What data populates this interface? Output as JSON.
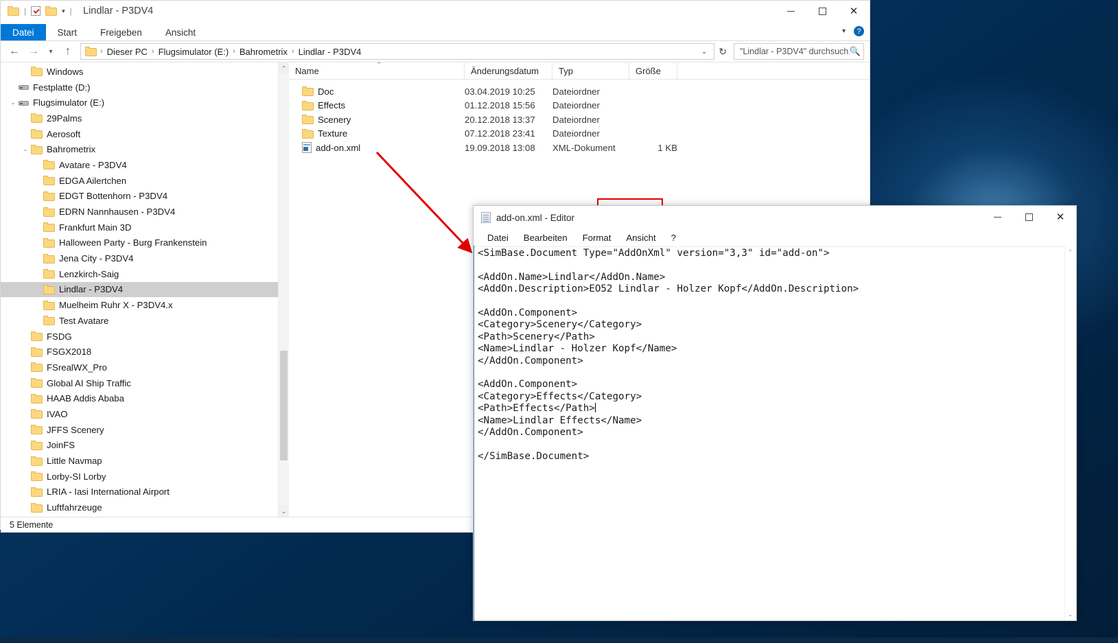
{
  "explorer": {
    "title": "Lindlar - P3DV4",
    "quick_access": {
      "folder_icon": "folder-icon",
      "properties_icon": "checkbox-red-check-icon",
      "new_folder_icon": "folder-icon",
      "dropdown_icon": "chevron-down-icon"
    },
    "ribbon_tabs": [
      {
        "label": "Datei",
        "active": true
      },
      {
        "label": "Start",
        "active": false
      },
      {
        "label": "Freigeben",
        "active": false
      },
      {
        "label": "Ansicht",
        "active": false
      }
    ],
    "ribbon_right": {
      "collapse_icon": "chevron-down-icon",
      "help_icon": "help-icon",
      "help_label": "?"
    },
    "window_controls": {
      "minimize": "minimize-icon",
      "maximize": "maximize-icon",
      "close": "close-icon"
    },
    "nav": {
      "back_icon": "arrow-left-icon",
      "forward_icon": "arrow-right-icon",
      "recent_icon": "chevron-down-icon",
      "up_icon": "arrow-up-icon"
    },
    "breadcrumbs": [
      "Dieser PC",
      "Flugsimulator (E:)",
      "Bahrometrix",
      "Lindlar - P3DV4"
    ],
    "address_dropdown_icon": "chevron-down-icon",
    "refresh_icon": "refresh-icon",
    "search": {
      "value": "\"Lindlar - P3DV4\" durchsuch...",
      "icon": "search-icon"
    },
    "tree": [
      {
        "label": "Windows",
        "indent": 2,
        "icon": "folder",
        "twisty": "",
        "selected": false
      },
      {
        "label": "Festplatte (D:)",
        "indent": 1,
        "icon": "drive",
        "twisty": "",
        "selected": false
      },
      {
        "label": "Flugsimulator (E:)",
        "indent": 1,
        "icon": "drive",
        "twisty": "v",
        "selected": false
      },
      {
        "label": "29Palms",
        "indent": 2,
        "icon": "folder",
        "twisty": "",
        "selected": false
      },
      {
        "label": "Aerosoft",
        "indent": 2,
        "icon": "folder",
        "twisty": "",
        "selected": false
      },
      {
        "label": "Bahrometrix",
        "indent": 2,
        "icon": "folder",
        "twisty": "v",
        "selected": false
      },
      {
        "label": "Avatare - P3DV4",
        "indent": 3,
        "icon": "folder",
        "twisty": "",
        "selected": false
      },
      {
        "label": "EDGA Ailertchen",
        "indent": 3,
        "icon": "folder",
        "twisty": "",
        "selected": false
      },
      {
        "label": "EDGT Bottenhorn - P3DV4",
        "indent": 3,
        "icon": "folder",
        "twisty": "",
        "selected": false
      },
      {
        "label": "EDRN Nannhausen - P3DV4",
        "indent": 3,
        "icon": "folder",
        "twisty": "",
        "selected": false
      },
      {
        "label": "Frankfurt Main 3D",
        "indent": 3,
        "icon": "folder",
        "twisty": "",
        "selected": false
      },
      {
        "label": "Halloween Party - Burg Frankenstein",
        "indent": 3,
        "icon": "folder",
        "twisty": "",
        "selected": false
      },
      {
        "label": "Jena City - P3DV4",
        "indent": 3,
        "icon": "folder",
        "twisty": "",
        "selected": false
      },
      {
        "label": "Lenzkirch-Saig",
        "indent": 3,
        "icon": "folder",
        "twisty": "",
        "selected": false
      },
      {
        "label": "Lindlar - P3DV4",
        "indent": 3,
        "icon": "folder",
        "twisty": "",
        "selected": true
      },
      {
        "label": "Muelheim Ruhr X - P3DV4.x",
        "indent": 3,
        "icon": "folder",
        "twisty": "",
        "selected": false
      },
      {
        "label": "Test Avatare",
        "indent": 3,
        "icon": "folder",
        "twisty": "",
        "selected": false
      },
      {
        "label": "FSDG",
        "indent": 2,
        "icon": "folder",
        "twisty": "",
        "selected": false
      },
      {
        "label": "FSGX2018",
        "indent": 2,
        "icon": "folder",
        "twisty": "",
        "selected": false
      },
      {
        "label": "FSrealWX_Pro",
        "indent": 2,
        "icon": "folder",
        "twisty": "",
        "selected": false
      },
      {
        "label": "Global AI Ship Traffic",
        "indent": 2,
        "icon": "folder",
        "twisty": "",
        "selected": false
      },
      {
        "label": "HAAB Addis Ababa",
        "indent": 2,
        "icon": "folder",
        "twisty": "",
        "selected": false
      },
      {
        "label": "IVAO",
        "indent": 2,
        "icon": "folder",
        "twisty": "",
        "selected": false
      },
      {
        "label": "JFFS Scenery",
        "indent": 2,
        "icon": "folder",
        "twisty": "",
        "selected": false
      },
      {
        "label": "JoinFS",
        "indent": 2,
        "icon": "folder",
        "twisty": "",
        "selected": false
      },
      {
        "label": "Little Navmap",
        "indent": 2,
        "icon": "folder",
        "twisty": "",
        "selected": false
      },
      {
        "label": "Lorby-SI Lorby",
        "indent": 2,
        "icon": "folder",
        "twisty": "",
        "selected": false
      },
      {
        "label": "LRIA - Iasi International Airport",
        "indent": 2,
        "icon": "folder",
        "twisty": "",
        "selected": false
      },
      {
        "label": "Luftfahrzeuge",
        "indent": 2,
        "icon": "folder",
        "twisty": "",
        "selected": false
      }
    ],
    "columns": [
      "Name",
      "Änderungsdatum",
      "Typ",
      "Größe"
    ],
    "files": [
      {
        "name": "Doc",
        "date": "03.04.2019 10:25",
        "type": "Dateiordner",
        "size": "",
        "icon": "folder",
        "highlighted": false
      },
      {
        "name": "Effects",
        "date": "01.12.2018 15:56",
        "type": "Dateiordner",
        "size": "",
        "icon": "folder",
        "highlighted": false
      },
      {
        "name": "Scenery",
        "date": "20.12.2018 13:37",
        "type": "Dateiordner",
        "size": "",
        "icon": "folder",
        "highlighted": false
      },
      {
        "name": "Texture",
        "date": "07.12.2018 23:41",
        "type": "Dateiordner",
        "size": "",
        "icon": "folder",
        "highlighted": false
      },
      {
        "name": "add-on.xml",
        "date": "19.09.2018 13:08",
        "type": "XML-Dokument",
        "size": "1 KB",
        "icon": "xml",
        "highlighted": true
      }
    ],
    "status": "5 Elemente",
    "scroll": {
      "up_icon": "chevron-up-icon",
      "down_icon": "chevron-down-icon"
    }
  },
  "notepad": {
    "title": "add-on.xml - Editor",
    "icon": "notepad-icon",
    "menu": [
      "Datei",
      "Bearbeiten",
      "Format",
      "Ansicht",
      "?"
    ],
    "window_controls": {
      "minimize": "minimize-icon",
      "maximize": "maximize-icon",
      "close": "close-icon"
    },
    "content_before_caret": "<SimBase.Document Type=\"AddOnXml\" version=\"3,3\" id=\"add-on\">\n\n<AddOn.Name>Lindlar</AddOn.Name>\n<AddOn.Description>EO52 Lindlar - Holzer Kopf</AddOn.Description>\n\n<AddOn.Component>\n<Category>Scenery</Category>\n<Path>Scenery</Path>\n<Name>Lindlar - Holzer Kopf</Name>\n</AddOn.Component>\n\n<AddOn.Component>\n<Category>Effects</Category>\n<Path>Effects</Path>",
    "content_after_caret": "\n<Name>Lindlar Effects</Name>\n</AddOn.Component>\n\n</SimBase.Document>",
    "scroll": {
      "up_icon": "chevron-up-icon",
      "down_icon": "chevron-down-icon"
    }
  },
  "annotation": {
    "arrow_color": "#e00000",
    "highlight_box_color": "#e00000"
  }
}
